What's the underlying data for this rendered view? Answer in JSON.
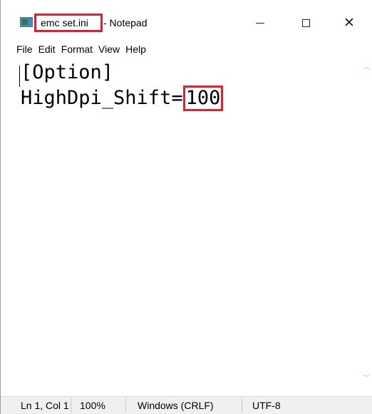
{
  "window": {
    "file_name": "emc set.ini",
    "title_suffix": "- Notepad",
    "icons": {
      "app": "notepad-icon",
      "minimize": "minimize-icon",
      "maximize": "maximize-icon",
      "close": "close-icon"
    },
    "highlight_color": "#e0202a"
  },
  "menu": {
    "items": [
      "File",
      "Edit",
      "Format",
      "View",
      "Help"
    ]
  },
  "editor": {
    "line1": "[Option]",
    "line2_key": "HighDpi_Shift=",
    "line2_value": "100"
  },
  "status": {
    "position": "Ln 1, Col 1",
    "zoom": "100%",
    "line_ending": "Windows (CRLF)",
    "encoding": "UTF-8"
  }
}
